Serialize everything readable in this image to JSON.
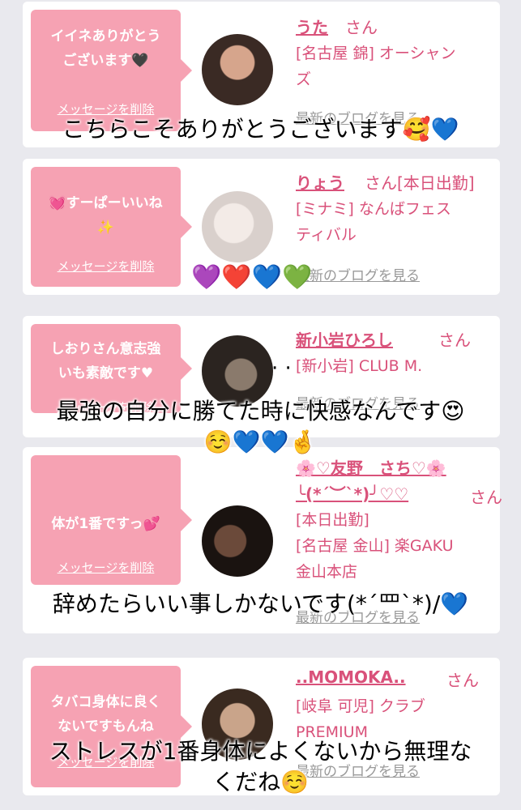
{
  "cards": [
    {
      "bubble": "イイネありがとう\nございます🖤",
      "delete_label": "メッセージを削除",
      "name": "うた",
      "san": "さん",
      "shop": "[名古屋 錦] オーシャン\nズ",
      "blog": "最新のブログを見る",
      "avatar_colors": [
        "#3a2a24",
        "#d6a58c"
      ]
    },
    {
      "bubble": "💓すーぱーいいね\n✨",
      "delete_label": "メッセージを削除",
      "name": "りょう",
      "san": "さん[本日出勤]",
      "shop": "[ミナミ] なんばフェス\nティバル",
      "blog": "最新のブログを見る",
      "avatar_colors": [
        "#d9d0cc",
        "#f3ebe7"
      ]
    },
    {
      "bubble": "しおりさん意志強\nいも素敵です♥",
      "delete_label": "メッセージを削除",
      "name": "新小岩ひろし",
      "san": "さん",
      "shop": "[新小岩] CLUB M.",
      "blog": "最新のブログを見る",
      "avatar_colors": [
        "#2b2420",
        "#8a7a6c"
      ]
    },
    {
      "bubble": "体が1番ですっ💕",
      "delete_label": "メッセージを削除",
      "name": "🌸♡友野　さち♡🌸\n╰(*´︶`*)╯♡♡",
      "san": "さん",
      "shop": "[本日出勤]\n[名古屋 金山] 楽GAKU\n金山本店",
      "blog": "最新のブログを見る",
      "avatar_colors": [
        "#1a1310",
        "#6b4a3a"
      ]
    },
    {
      "bubble": "タバコ身体に良く\nないですもんね",
      "delete_label": "メッセージを削除",
      "name": "..MOMOKA..",
      "san": "さん",
      "shop": "[岐阜 可児] クラブ\nPREMIUM",
      "blog": "最新のブログを見る",
      "avatar_colors": [
        "#3a2a20",
        "#c9a48a"
      ]
    }
  ],
  "overlays": {
    "o1": "こちらこそありがとうございます🥰💙",
    "o2_emoji": "💜❤️💙💚",
    "o3_dots": "· ·",
    "o3_line1": "最強の自分に勝てた時に快感なんです😍",
    "o3_line2": "☺️💙💙🤞",
    "o4": "辞めたらいい事しかないです(*´罒`*)/💙",
    "o5_line1": "ストレスが1番身体によくないから無理な",
    "o5_line2": "くだね☺️"
  },
  "colors": {
    "pink": "#f6a2b3",
    "name": "#d9517a",
    "muted": "#999999",
    "background": "#e9e9ee"
  }
}
